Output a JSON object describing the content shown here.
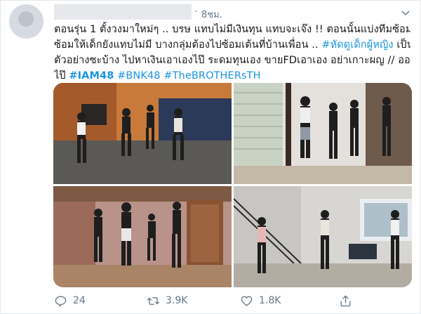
{
  "tweet": {
    "time": "8ชม.",
    "separator": "·",
    "text": {
      "line1": "ตอนรุ่น 1 ตั้งวงมาใหม่ๆ .. บรษ แทบไม่มีเงินทุน แทบจะเจ๊ง !! ตอนนั้นแบ่งทีมซ้อม ห้อง",
      "line2_prefix": "ซ้อมให้เด็กยังแทบไม่มี บางกลุ่มต้องไปซ้อมเต้นที่บ้านเพื่อน .. ",
      "line2_hashtag": "#หัดดูเด็กผู้หญิง",
      "line2_suffix": " เป็น",
      "line3": "ตัวอย่างซะบ้าง ไปหาเงินเอาเองไป๊ ระดมทุนเอง ขายFDเอาเอง อย่าเกาะผญ  // ออก",
      "line4_prefix": "ไป๊ ",
      "hashtag_iam48": "#IAM48",
      "hashtag_bnk48": "#BNK48",
      "hashtag_brothers": "#TheBROTHERsTH"
    },
    "actions": {
      "replies": "24",
      "retweets": "3.9K",
      "likes": "1.8K"
    }
  },
  "icons": {
    "menu": "chevron-down-icon",
    "reply": "reply-icon",
    "retweet": "retweet-icon",
    "like": "heart-icon",
    "share": "share-icon"
  },
  "colors": {
    "link": "#1b95e0",
    "muted": "#657786",
    "text": "#14171a",
    "border": "#e1e8ed"
  }
}
